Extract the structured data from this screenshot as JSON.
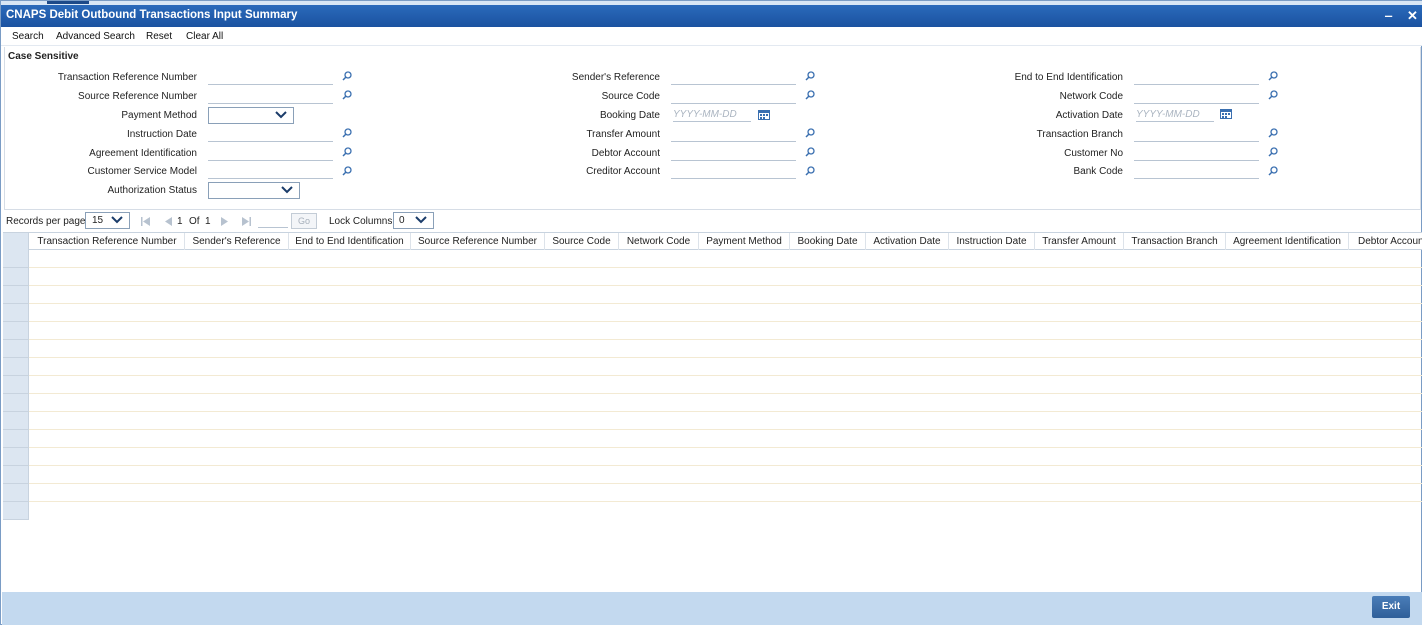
{
  "window": {
    "title": "CNAPS Debit Outbound Transactions Input Summary",
    "minimize": "‒",
    "close": "✕"
  },
  "toolbar": {
    "search": "Search",
    "advanced_search": "Advanced Search",
    "reset": "Reset",
    "clear_all": "Clear All"
  },
  "form": {
    "legend": "Case Sensitive",
    "col1": {
      "transaction_reference_number": "Transaction Reference Number",
      "source_reference_number": "Source Reference Number",
      "payment_method": "Payment Method",
      "instruction_date": "Instruction Date",
      "agreement_identification": "Agreement Identification",
      "customer_service_model": "Customer Service Model",
      "authorization_status": "Authorization Status"
    },
    "col2": {
      "senders_reference": "Sender's Reference",
      "source_code": "Source Code",
      "booking_date": "Booking Date",
      "transfer_amount": "Transfer Amount",
      "debtor_account": "Debtor Account",
      "creditor_account": "Creditor Account"
    },
    "col3": {
      "end_to_end_identification": "End to End Identification",
      "network_code": "Network Code",
      "activation_date": "Activation Date",
      "transaction_branch": "Transaction Branch",
      "customer_no": "Customer No",
      "bank_code": "Bank Code"
    },
    "date_placeholder": "YYYY-MM-DD"
  },
  "pager": {
    "records_per_page_label": "Records per page",
    "records_per_page_value": "15",
    "current_page": "1",
    "of_label": "Of",
    "total_pages": "1",
    "go_label": "Go",
    "lock_columns_label": "Lock Columns",
    "lock_columns_value": "0"
  },
  "grid": {
    "columns": [
      "Transaction Reference Number",
      "Sender's Reference",
      "End to End Identification",
      "Source Reference Number",
      "Source Code",
      "Network Code",
      "Payment Method",
      "Booking Date",
      "Activation Date",
      "Instruction Date",
      "Transfer Amount",
      "Transaction Branch",
      "Agreement Identification",
      "Debtor Account"
    ]
  },
  "footer": {
    "exit": "Exit"
  },
  "colors": {
    "title_bar": "#1f5ba8",
    "footer": "#c3d9ef",
    "row_header": "#dce6f1",
    "icon_blue": "#3a6fb0"
  },
  "icons": [
    "search-icon",
    "calendar-icon",
    "chevron-down-icon",
    "first-page-icon",
    "prev-page-icon",
    "next-page-icon",
    "last-page-icon"
  ]
}
